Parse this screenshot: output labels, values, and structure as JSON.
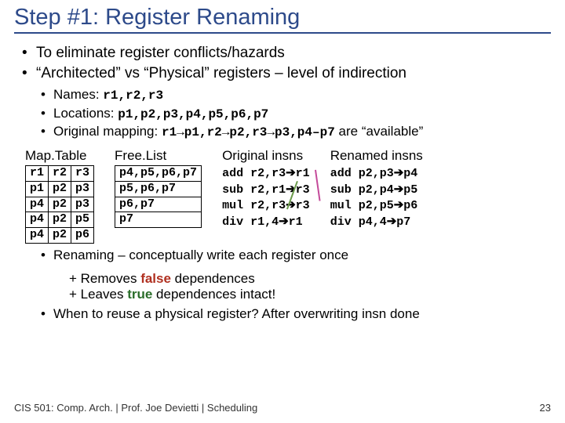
{
  "title": "Step #1: Register Renaming",
  "bullets": {
    "b1": "To eliminate register conflicts/hazards",
    "b2": "“Architected” vs “Physical” registers – level of indirection",
    "s1a": "Names: ",
    "s1b": "r1,r2,r3",
    "s2a": "Locations: ",
    "s2b": "p1,p2,p3,p4,p5,p6,p7",
    "s3a": "Original mapping: ",
    "s3b": "r1→p1,r2→p2,r3→p3,p4–p7",
    "s3c": " are “available”"
  },
  "cols": {
    "map": "Map.Table",
    "free": "Free.List",
    "orig": "Original insns",
    "ren": "Renamed insns"
  },
  "map": {
    "h1": "r1",
    "h2": "r2",
    "h3": "r3",
    "r1c1": "p1",
    "r1c2": "p2",
    "r1c3": "p3",
    "r2c1": "p4",
    "r2c2": "p2",
    "r2c3": "p3",
    "r3c1": "p4",
    "r3c2": "p2",
    "r3c3": "p5",
    "r4c1": "p4",
    "r4c2": "p2",
    "r4c3": "p6"
  },
  "free": {
    "r1": "p4,p5,p6,p7",
    "r2": "p5,p6,p7",
    "r3": "p6,p7",
    "r4": "p7"
  },
  "orig": {
    "l1a": "add r2,r3",
    "l1b": "r1",
    "l2a": "sub r2,r1",
    "l2b": "r3",
    "l3a": "mul r2,r3",
    "l3b": "r3",
    "l4a": "div r1,4",
    "l4b": "r1"
  },
  "ren": {
    "l1a": "add p2,p3",
    "l1b": "p4",
    "l2a": "sub p2,p4",
    "l2b": "p5",
    "l3a": "mul p2,p5",
    "l3b": "p6",
    "l4a": "div p4,4",
    "l4b": "p7"
  },
  "bottom": {
    "b1": "Renaming – conceptually write each register once",
    "p1a": "+ Removes ",
    "p1b": "false",
    "p1c": " dependences",
    "p2a": "+ Leaves ",
    "p2b": "true",
    "p2c": " dependences intact!",
    "b2": "When to reuse a physical register?  After overwriting insn done"
  },
  "footer": {
    "left": "CIS 501: Comp. Arch.  |  Prof. Joe Devietti  |  Scheduling",
    "right": "23"
  }
}
